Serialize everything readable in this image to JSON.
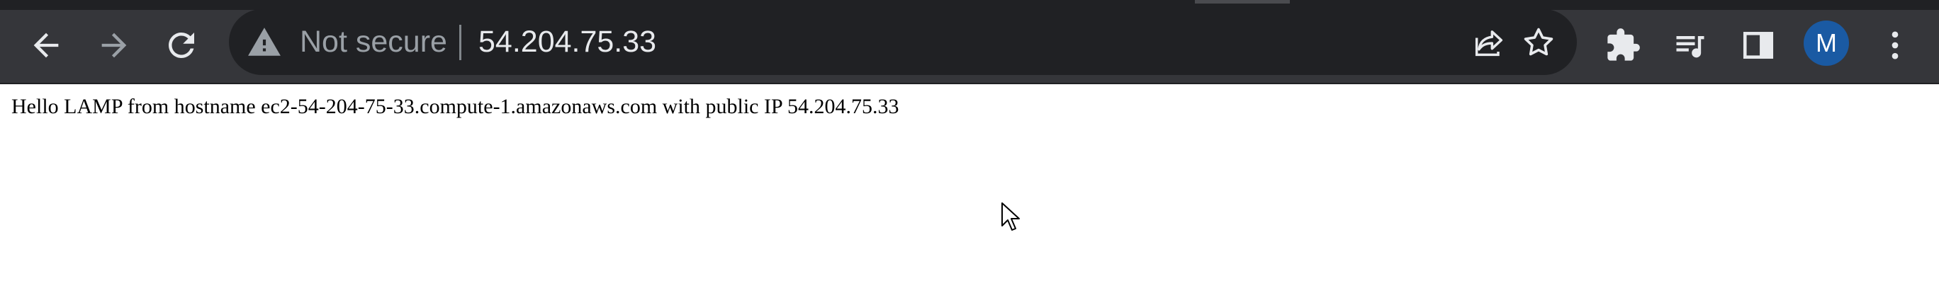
{
  "browser": {
    "security_label": "Not secure",
    "url": "54.204.75.33",
    "profile_initial": "M",
    "icons": {
      "back": "arrow-left-icon",
      "forward": "arrow-right-icon",
      "reload": "reload-icon",
      "security": "warning-triangle-icon",
      "share": "share-icon",
      "bookmark": "star-icon",
      "extensions": "puzzle-icon",
      "media": "playlist-music-icon",
      "side_panel": "side-panel-icon",
      "menu": "kebab-menu-icon"
    },
    "colors": {
      "toolbar_bg": "#35363a",
      "omnibox_bg": "#202124",
      "icon": "#e8eaed",
      "disabled_icon": "#9aa0a6",
      "avatar_bg": "#1a5aa3"
    }
  },
  "page": {
    "text": "Hello LAMP from hostname ec2-54-204-75-33.compute-1.amazonaws.com with public IP 54.204.75.33"
  }
}
